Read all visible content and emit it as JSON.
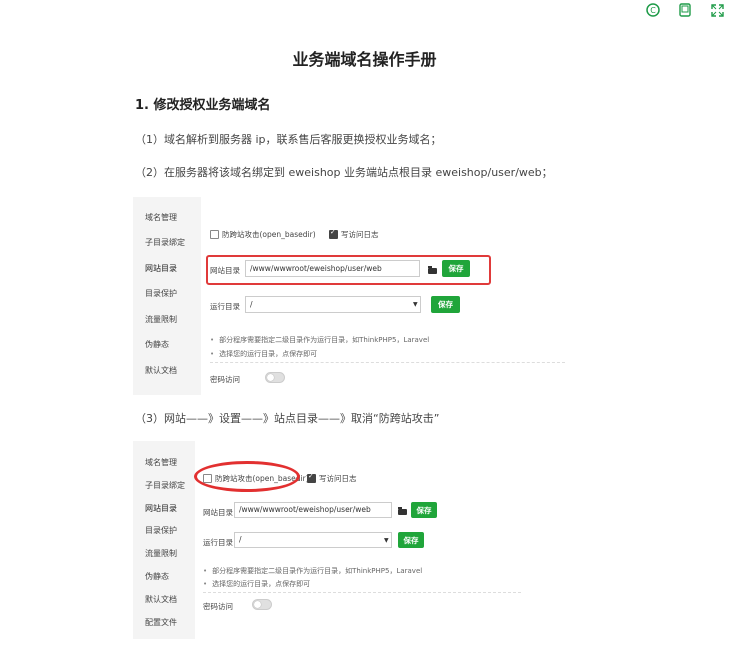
{
  "toolbar": {
    "icons": [
      "copyright-icon",
      "tablet-icon",
      "fullscreen-icon"
    ]
  },
  "doc": {
    "title": "业务端域名操作手册",
    "heading1": "1. 修改授权业务端域名",
    "step1": "（1）域名解析到服务器 ip，联系售后客服更换授权业务域名；",
    "step2": "（2）在服务器将该域名绑定到 eweishop 业务端站点根目录 eweishop/user/web；",
    "step3": "（3）网站——》设置——》站点目录——》取消“防跨站攻击”"
  },
  "panel": {
    "sidebar": [
      "域名管理",
      "子目录绑定",
      "网站目录",
      "目录保护",
      "流量限制",
      "伪静态",
      "默认文档"
    ],
    "sidebar_extra": "配置文件",
    "cb_anti": "防跨站攻击(open_basedir)",
    "cb_log": "写访问日志",
    "site_dir_label": "网站目录",
    "site_dir_value": "/www/wwwroot/eweishop/user/web",
    "run_dir_label": "运行目录",
    "run_dir_value": "/",
    "save": "保存",
    "note1": "部分程序需要指定二级目录作为运行目录，如ThinkPHP5，Laravel",
    "note2": "选择您的运行目录，点保存即可",
    "pwd_label": "密码访问"
  },
  "colors": {
    "accent": "#20a53a",
    "highlight": "#e03a3a"
  }
}
